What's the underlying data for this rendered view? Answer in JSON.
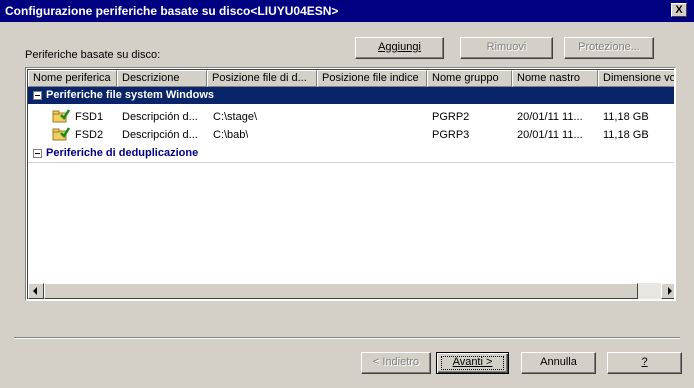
{
  "window": {
    "title": "Configurazione periferiche basate su disco<LIUYU04ESN>",
    "close_label": "X"
  },
  "section_label": "Periferiche basate su disco:",
  "top_buttons": {
    "add": "Aggiungi",
    "remove": "Rimuovi",
    "protection": "Protezione..."
  },
  "columns": [
    "Nome periferica",
    "Descrizione",
    "Posizione file di d...",
    "Posizione file indice",
    "Nome gruppo",
    "Nome nastro",
    "Dimensione volu"
  ],
  "groups": [
    {
      "label": "Periferiche file system Windows",
      "selected": true,
      "rows": [
        {
          "name": "FSD1",
          "description": "Descripción d...",
          "data_path": "C:\\stage\\",
          "index_path": "",
          "group": "PGRP2",
          "tape": "20/01/11 11...",
          "size": "11,18 GB"
        },
        {
          "name": "FSD2",
          "description": "Descripción d...",
          "data_path": "C:\\bab\\",
          "index_path": "",
          "group": "PGRP3",
          "tape": "20/01/11 11...",
          "size": "11,18 GB"
        }
      ]
    },
    {
      "label": "Periferiche di deduplicazione",
      "selected": false,
      "rows": []
    }
  ],
  "bottom_buttons": {
    "back": "< Indietro",
    "next": "Avanti >",
    "cancel": "Annulla",
    "help": "?"
  },
  "scroll_left_icon": "arrow-left-icon",
  "scroll_right_icon": "arrow-right-icon",
  "row_icon": "folder-check-icon"
}
